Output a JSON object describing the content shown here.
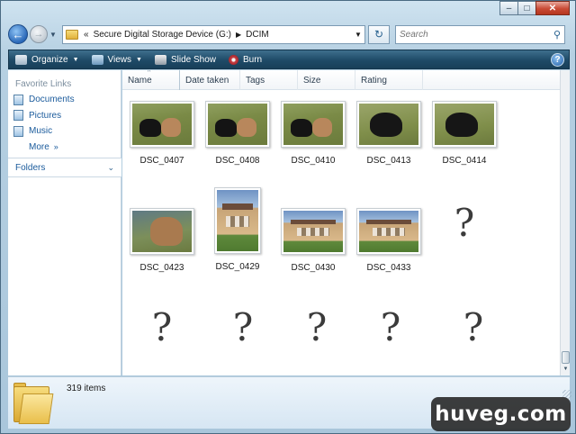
{
  "window": {
    "caption": {
      "minimize": "–",
      "maximize": "□",
      "close": "✕"
    }
  },
  "nav": {
    "back_glyph": "←",
    "forward_glyph": "→",
    "dropdown_glyph": "▼",
    "address": {
      "prefix": "«",
      "crumbs": [
        "Secure Digital Storage Device (G:)",
        "DCIM"
      ],
      "separator": "▶",
      "dropdown_glyph": "▼"
    },
    "refresh_glyph": "↻",
    "search": {
      "placeholder": "Search",
      "icon_glyph": "⚲"
    }
  },
  "toolbar": {
    "organize": "Organize",
    "views": "Views",
    "slideshow": "Slide Show",
    "burn": "Burn",
    "dropdown_glyph": "▼",
    "help": "?"
  },
  "sidebar": {
    "favorites_title": "Favorite Links",
    "links": [
      "Documents",
      "Pictures",
      "Music"
    ],
    "more": "More",
    "more_arrow": "»",
    "folders": "Folders",
    "folders_chevron": "⌄"
  },
  "columns": {
    "sort_indicator": "^",
    "headers": [
      "Name",
      "Date taken",
      "Tags",
      "Size",
      "Rating"
    ]
  },
  "files": [
    {
      "name": "DSC_0407",
      "kind": "dog-grass"
    },
    {
      "name": "DSC_0408",
      "kind": "dog-grass"
    },
    {
      "name": "DSC_0410",
      "kind": "dog-grass"
    },
    {
      "name": "DSC_0413",
      "kind": "dog-black"
    },
    {
      "name": "DSC_0414",
      "kind": "dog-black"
    },
    {
      "name": "DSC_0423",
      "kind": "dog-brown"
    },
    {
      "name": "DSC_0429",
      "kind": "house"
    },
    {
      "name": "DSC_0430",
      "kind": "house"
    },
    {
      "name": "DSC_0433",
      "kind": "house"
    }
  ],
  "unknown_glyph": "?",
  "details": {
    "item_count": "319 items"
  },
  "watermark": "huveg.com"
}
